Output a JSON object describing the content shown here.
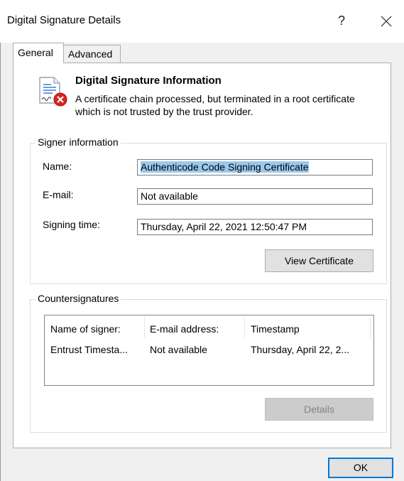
{
  "window": {
    "title": "Digital Signature Details",
    "help_glyph": "?"
  },
  "tabs": [
    {
      "label": "General",
      "selected": true
    },
    {
      "label": "Advanced",
      "selected": false
    }
  ],
  "signature_info": {
    "heading": "Digital Signature Information",
    "message": "A certificate chain processed, but terminated in a root certificate which is not trusted by the trust provider.",
    "icon": "certificate-error-icon"
  },
  "signer_info": {
    "legend": "Signer information",
    "name_label": "Name:",
    "name_value": "Authenticode Code Signing Certificate",
    "email_label": "E-mail:",
    "email_value": "Not available",
    "signing_time_label": "Signing time:",
    "signing_time_value": "Thursday, April 22, 2021 12:50:47 PM",
    "view_certificate_label": "View Certificate"
  },
  "countersignatures": {
    "legend": "Countersignatures",
    "columns": [
      "Name of signer:",
      "E-mail address:",
      "Timestamp"
    ],
    "rows": [
      [
        "Entrust Timesta...",
        "Not available",
        "Thursday, April 22, 2..."
      ]
    ],
    "details_label": "Details"
  },
  "footer": {
    "ok_label": "OK"
  },
  "colors": {
    "selection": "#99c9ef",
    "focus_border": "#0078d7",
    "error_red": "#d9261c"
  }
}
